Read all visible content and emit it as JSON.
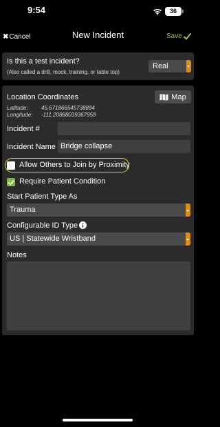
{
  "status_bar": {
    "time": "9:54",
    "battery": "36",
    "icons": [
      "wifi-icon",
      "battery-icon"
    ]
  },
  "nav": {
    "cancel_label": "Cancel",
    "title": "New Incident",
    "save_label": "Save",
    "save_color": "#a3be3c"
  },
  "test_incident": {
    "question": "Is this a test incident?",
    "hint": "(Also called a drill, mock, training, or table top)",
    "value": "Real"
  },
  "location": {
    "heading": "Location Coordinates",
    "map_label": "Map",
    "latitude_label": "Latitude:",
    "latitude_value": "45.671866545738894",
    "longitude_label": "Longitude:",
    "longitude_value": "-111.20888039367959"
  },
  "fields": {
    "incident_number_label": "Incident #",
    "incident_number_value": "",
    "incident_name_label": "Incident Name",
    "incident_name_value": "Bridge collapse"
  },
  "options": {
    "allow_join_label": "Allow Others to Join by Proximity",
    "allow_join_checked": false,
    "require_condition_label": "Require Patient Condition",
    "require_condition_checked": true
  },
  "patient_type": {
    "label": "Start Patient Type As",
    "value": "Trauma"
  },
  "id_type": {
    "label": "Configurable ID Type",
    "value": "US | Statewide Wristband"
  },
  "notes": {
    "label": "Notes",
    "value": ""
  },
  "colors": {
    "accent_orange": "#e08a12",
    "check_green": "#7cbf3e",
    "highlight_yellow": "#e9d531"
  }
}
